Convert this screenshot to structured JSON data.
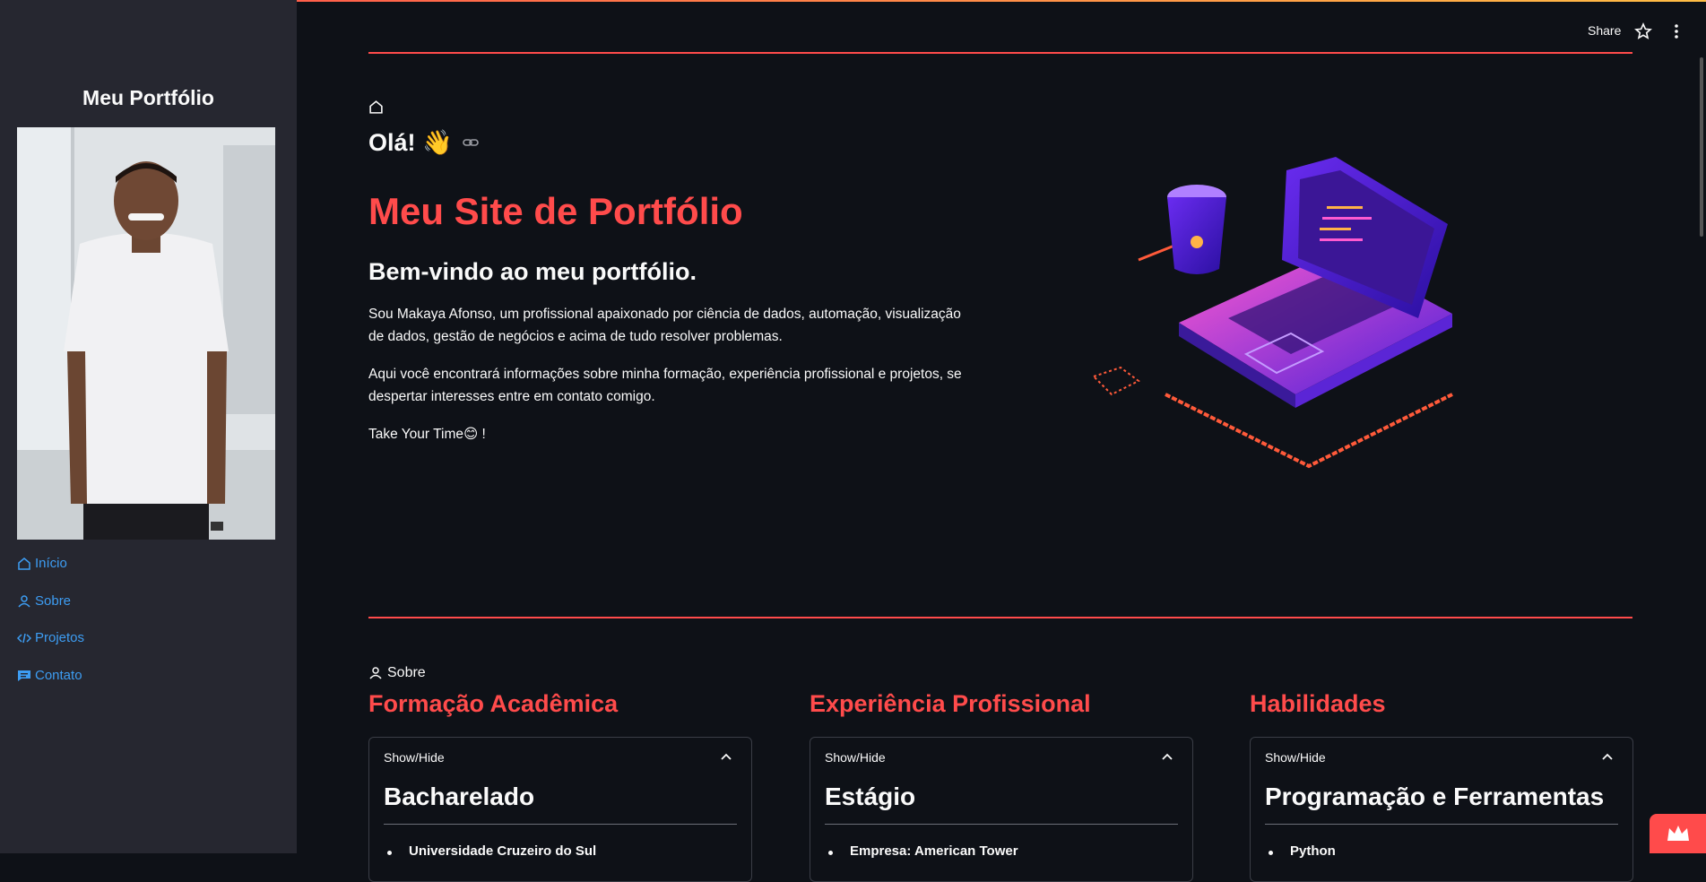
{
  "header": {
    "share_label": "Share"
  },
  "sidebar": {
    "title": "Meu Portfólio",
    "items": [
      {
        "label": "Início",
        "icon": "home-icon"
      },
      {
        "label": "Sobre",
        "icon": "person-icon"
      },
      {
        "label": "Projetos",
        "icon": "code-icon"
      },
      {
        "label": "Contato",
        "icon": "chat-icon"
      }
    ]
  },
  "hero": {
    "greeting": "Olá! 👋",
    "title": "Meu Site de Portfólio",
    "subtitle": "Bem-vindo ao meu portfólio.",
    "paragraph1": "Sou Makaya Afonso, um profissional apaixonado por ciência de dados, automação, visualização de dados, gestão de negócios e acima de tudo resolver problemas.",
    "paragraph2": "Aqui você encontrará informações sobre minha formação, experiência profissional e projetos, se despertar interesses entre em contato comigo.",
    "paragraph3": "Take Your Time😊 !"
  },
  "about": {
    "section_label": "Sobre",
    "columns": [
      {
        "title": "Formação Acadêmica",
        "toggle": "Show/Hide",
        "heading": "Bacharelado",
        "first_item": "Universidade Cruzeiro do Sul"
      },
      {
        "title": "Experiência Profissional",
        "toggle": "Show/Hide",
        "heading": "Estágio",
        "first_item": "Empresa: American Tower"
      },
      {
        "title": "Habilidades",
        "toggle": "Show/Hide",
        "heading": "Programação e Ferramentas",
        "first_item": "Python"
      }
    ]
  },
  "colors": {
    "accent": "#ff4b4b",
    "link": "#3d9df3",
    "background": "#0e1117",
    "sidebar": "#262730"
  }
}
